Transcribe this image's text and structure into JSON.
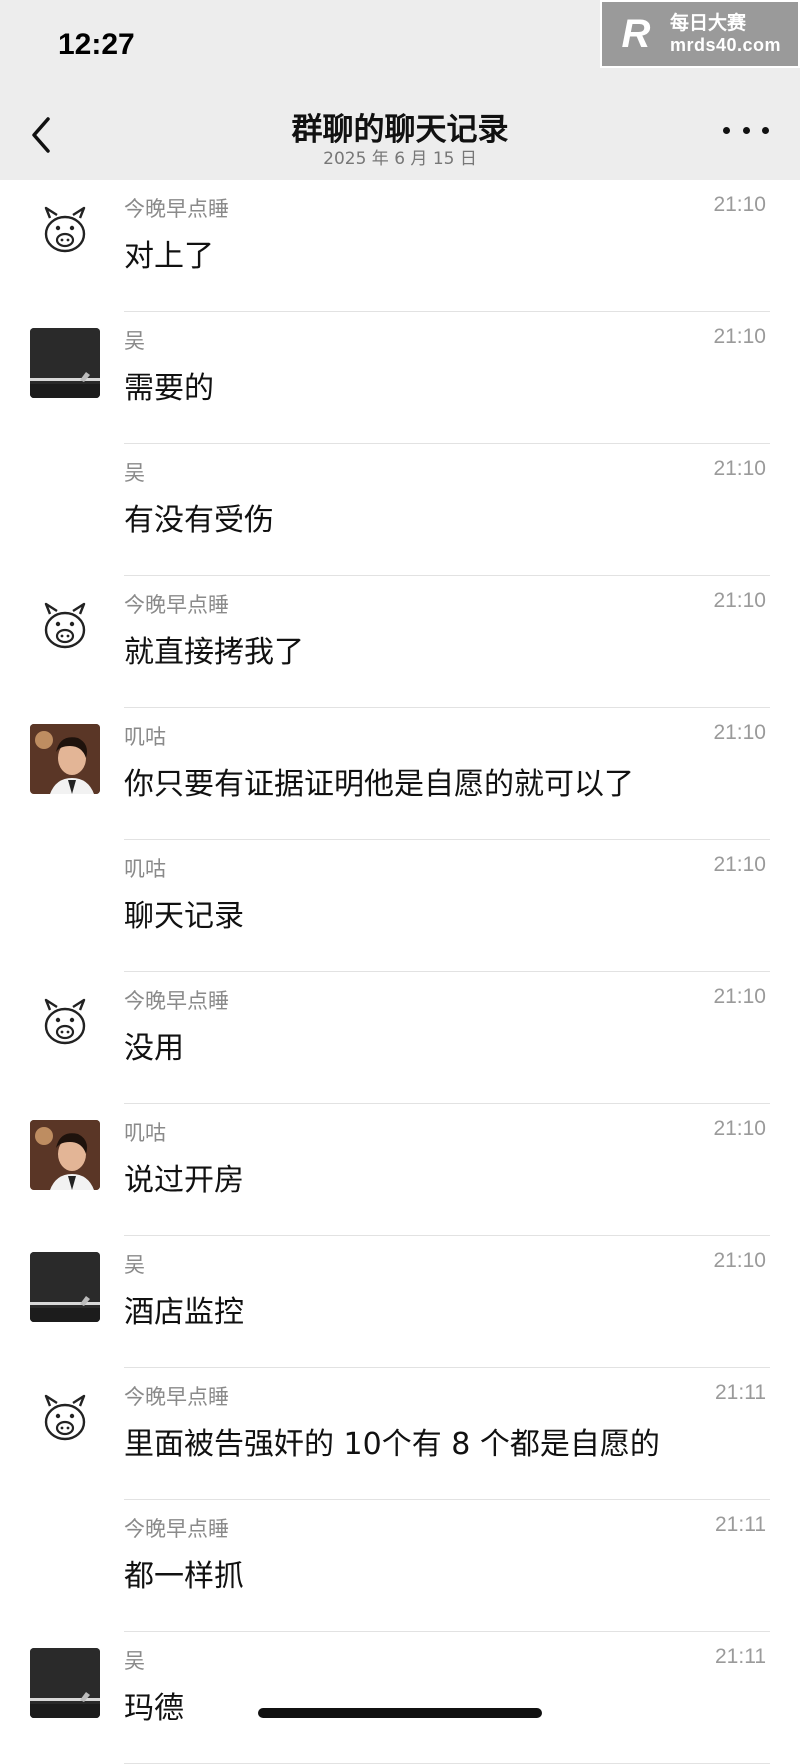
{
  "status_bar": {
    "time": "12:27"
  },
  "watermark": {
    "logo": "R",
    "line1": "每日大赛",
    "line2": "mrds40.com"
  },
  "header": {
    "title": "群聊的聊天记录",
    "subtitle": "2025 年 6 月 15 日",
    "back_icon": "chevron-left-icon",
    "more_icon": "ellipsis-icon"
  },
  "messages": [
    {
      "sender": "今晚早点睡",
      "time": "21:10",
      "text": "对上了",
      "avatar": "pig"
    },
    {
      "sender": "吴",
      "time": "21:10",
      "text": "需要的",
      "avatar": "dark"
    },
    {
      "sender": "吴",
      "time": "21:10",
      "text": "有没有受伤",
      "avatar": "none"
    },
    {
      "sender": "今晚早点睡",
      "time": "21:10",
      "text": "就直接拷我了",
      "avatar": "pig"
    },
    {
      "sender": "叽咕",
      "time": "21:10",
      "text": "你只要有证据证明他是自愿的就可以了",
      "avatar": "photo"
    },
    {
      "sender": "叽咕",
      "time": "21:10",
      "text": "聊天记录",
      "avatar": "none"
    },
    {
      "sender": "今晚早点睡",
      "time": "21:10",
      "text": "没用",
      "avatar": "pig"
    },
    {
      "sender": "叽咕",
      "time": "21:10",
      "text": "说过开房",
      "avatar": "photo"
    },
    {
      "sender": "吴",
      "time": "21:10",
      "text": "酒店监控",
      "avatar": "dark"
    },
    {
      "sender": "今晚早点睡",
      "time": "21:11",
      "text": "里面被告强奸的 10个有 8 个都是自愿的",
      "avatar": "pig"
    },
    {
      "sender": "今晚早点睡",
      "time": "21:11",
      "text": "都一样抓",
      "avatar": "none"
    },
    {
      "sender": "吴",
      "time": "21:11",
      "text": "玛德",
      "avatar": "dark"
    }
  ],
  "colors": {
    "header_bg": "#ededed",
    "background": "#ffffff",
    "meta_text": "#8a8a8a"
  }
}
